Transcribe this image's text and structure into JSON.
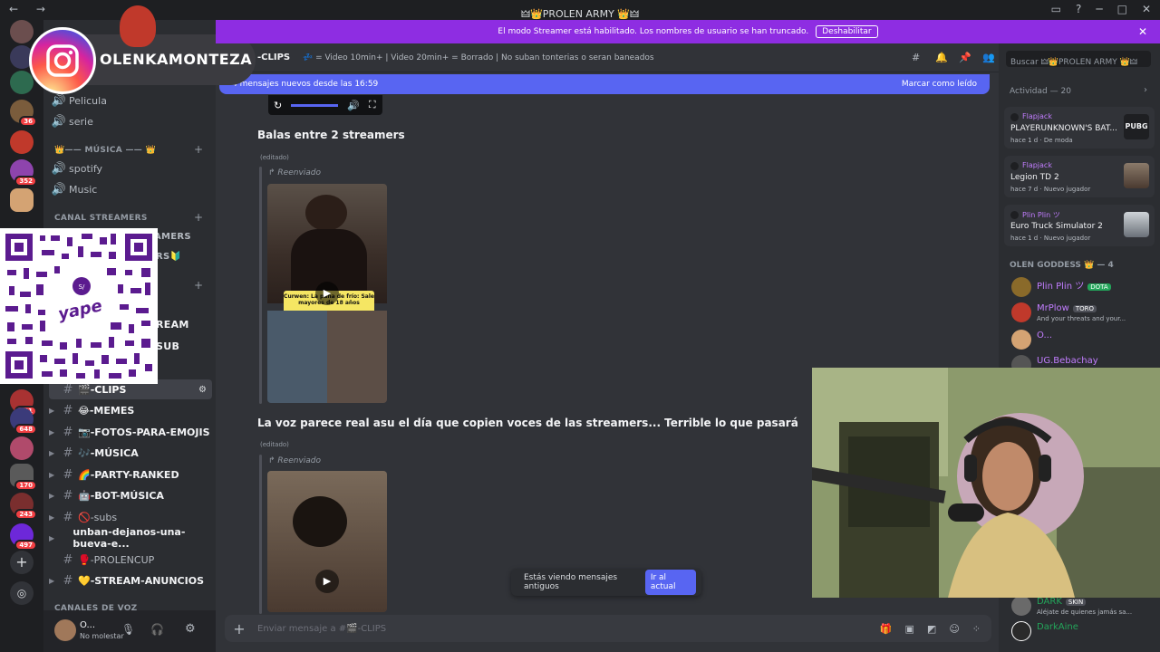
{
  "window": {
    "title": "🜲👑PROLEN ARMY 👑🜲"
  },
  "streamer_bar": {
    "text": "El modo Streamer está habilitado. Los nombres de usuario se han truncado.",
    "button": "Deshabilitar"
  },
  "overlay": {
    "instagram_handle": "OLENKAMONTEZA",
    "qr_brand": "yape"
  },
  "sidebar": {
    "channels_top": [
      {
        "label": "Pelicula"
      },
      {
        "label": "serie"
      }
    ],
    "category_musica": "👑—— MÚSICA —— 👑",
    "channels_musica": [
      {
        "label": "spotify"
      },
      {
        "label": "Music"
      }
    ],
    "category_streamers": "CANAL STREAMERS",
    "channels_streamers_partial": [
      "AMERS",
      "RS🔰"
    ],
    "partial_items": [
      "REAM",
      "SUB"
    ],
    "channels_main": [
      {
        "label": "🎬-CLIPS",
        "active": true
      },
      {
        "label": "😂-MEMES"
      },
      {
        "label": "📷-FOTOS-PARA-EMOJIS"
      },
      {
        "label": "🎶-MÚSICA"
      },
      {
        "label": "🌈-PARTY-RANKED"
      },
      {
        "label": "🤖-BOT-MÚSICA"
      },
      {
        "label": "🚫-subs"
      },
      {
        "label": "unban-dejanos-una-bueva-e..."
      },
      {
        "label": "🥊-PROLENCUP"
      },
      {
        "label": "💛-STREAM-ANUNCIOS"
      }
    ],
    "category_voz": "CANALES DE VOZ",
    "server_badges": [
      "36",
      "352",
      "241",
      "648",
      "170",
      "243",
      "497"
    ],
    "user": {
      "name": "O...",
      "status": "No molestar"
    }
  },
  "channel_header": {
    "name": "-CLIPS",
    "topic": "💤 = Video 10min+ | Video 20min+ = Borrado | No suban tonterias o seran baneados",
    "search_placeholder": "Buscar 🜲👑PROLEN ARMY 👑🜲"
  },
  "new_messages": {
    "text": "4 mensajes nuevos desde las 16:59",
    "action": "Marcar como leído"
  },
  "messages": [
    {
      "text": "Balas entre 2 streamers",
      "edited": "(editado)",
      "forwarded": "Reenviado",
      "video_caption": "Curwen: La pana de frío: Sale mayores de 18 años"
    },
    {
      "text": "La voz parece real asu el día que copien voces de las streamers... Terrible lo que pasará",
      "edited": "(editado)",
      "forwarded": "Reenviado"
    }
  ],
  "old_messages_bar": {
    "text": "Estás viendo mensajes antiguos",
    "button": "Ir al actual"
  },
  "composer": {
    "placeholder": "Enviar mensaje a #🎬-CLIPS"
  },
  "activity": {
    "header": "Actividad — 20",
    "items": [
      {
        "user": "Flapjack",
        "game": "PLAYERUNKNOWN'S BAT...",
        "time": "hace 1 d",
        "extra": "De moda",
        "art": "PUBG"
      },
      {
        "user": "Flapjack",
        "game": "Legion TD 2",
        "time": "hace 7 d",
        "extra": "Nuevo jugador"
      },
      {
        "user": "Plin Plin ツ",
        "game": "Euro Truck Simulator 2",
        "time": "hace 1 d",
        "extra": "Nuevo jugador"
      }
    ]
  },
  "members": {
    "group_header": "OLEN GODDESS 👑 — 4",
    "items": [
      {
        "name": "Plin Plin ツ",
        "tag": "DOTA",
        "tag_color": "#23a55a"
      },
      {
        "name": "MrPlow",
        "tag": "TORO",
        "tag_color": "#4e5058",
        "status": "And your threats and your..."
      },
      {
        "name": "O..."
      },
      {
        "name": "UG.Bebachay"
      }
    ],
    "bottom": [
      {
        "name": "DARK",
        "tag": "SKIN",
        "status": "Aléjate de quienes jamás sa..."
      },
      {
        "name": "DarkAine"
      }
    ]
  },
  "colors": {
    "streamer_bar": "#8e2de2",
    "blurple": "#5865f2",
    "bg_main": "#313338",
    "bg_sidebar": "#2b2d31",
    "bg_rail": "#1e1f22",
    "name_purple": "#c27dff"
  }
}
